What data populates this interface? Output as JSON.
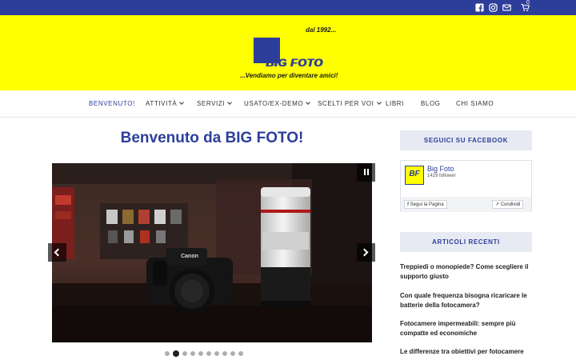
{
  "topbar": {
    "icons": [
      "facebook-icon",
      "instagram-icon",
      "mail-icon",
      "cart-icon"
    ],
    "cart_count": "0",
    "color": "#2d3e9a"
  },
  "header": {
    "background": "#ffff00",
    "logo": {
      "since": "dal 1992...",
      "brand": "BIG FOTO",
      "tagline": "...Vendiamo per diventare amici!"
    }
  },
  "nav": {
    "items": [
      {
        "label": "BENVENUTO!",
        "dropdown": false
      },
      {
        "label": "ATTIVITÀ",
        "dropdown": true
      },
      {
        "label": "SERVIZI",
        "dropdown": true
      },
      {
        "label": "USATO/EX-DEMO",
        "dropdown": true
      },
      {
        "label": "SCELTI PER VOI",
        "dropdown": true
      },
      {
        "label": "LIBRI",
        "dropdown": false
      },
      {
        "label": "BLOG",
        "dropdown": false
      },
      {
        "label": "CHI SIAMO",
        "dropdown": false
      }
    ]
  },
  "main": {
    "title": "Benvenuto da BIG FOTO!",
    "slider": {
      "slide_count": 10,
      "active_slide": 2,
      "camera_brand": "Canon"
    }
  },
  "sidebar": {
    "facebook": {
      "title": "SEGUICI SU FACEBOOK",
      "page_name": "Big Foto",
      "followers": "1429 follower",
      "logo_text": "BF",
      "follow_label": "Segui la Pagina",
      "share_label": "Condividi"
    },
    "recent": {
      "title": "ARTICOLI RECENTI",
      "posts": [
        "Treppiedi o monopiede? Come scegliere il supporto giusto",
        "Con quale frequenza bisogna ricaricare le batterie della fotocamera?",
        "Fotocamere impermeabili: sempre più compatte ed economiche",
        "Le differenze tra obiettivi per fotocamere"
      ]
    }
  },
  "colors": {
    "accent": "#2d3e9a",
    "header_yellow": "#ffff00",
    "sidebar_title_bg": "#e7eaf2"
  }
}
